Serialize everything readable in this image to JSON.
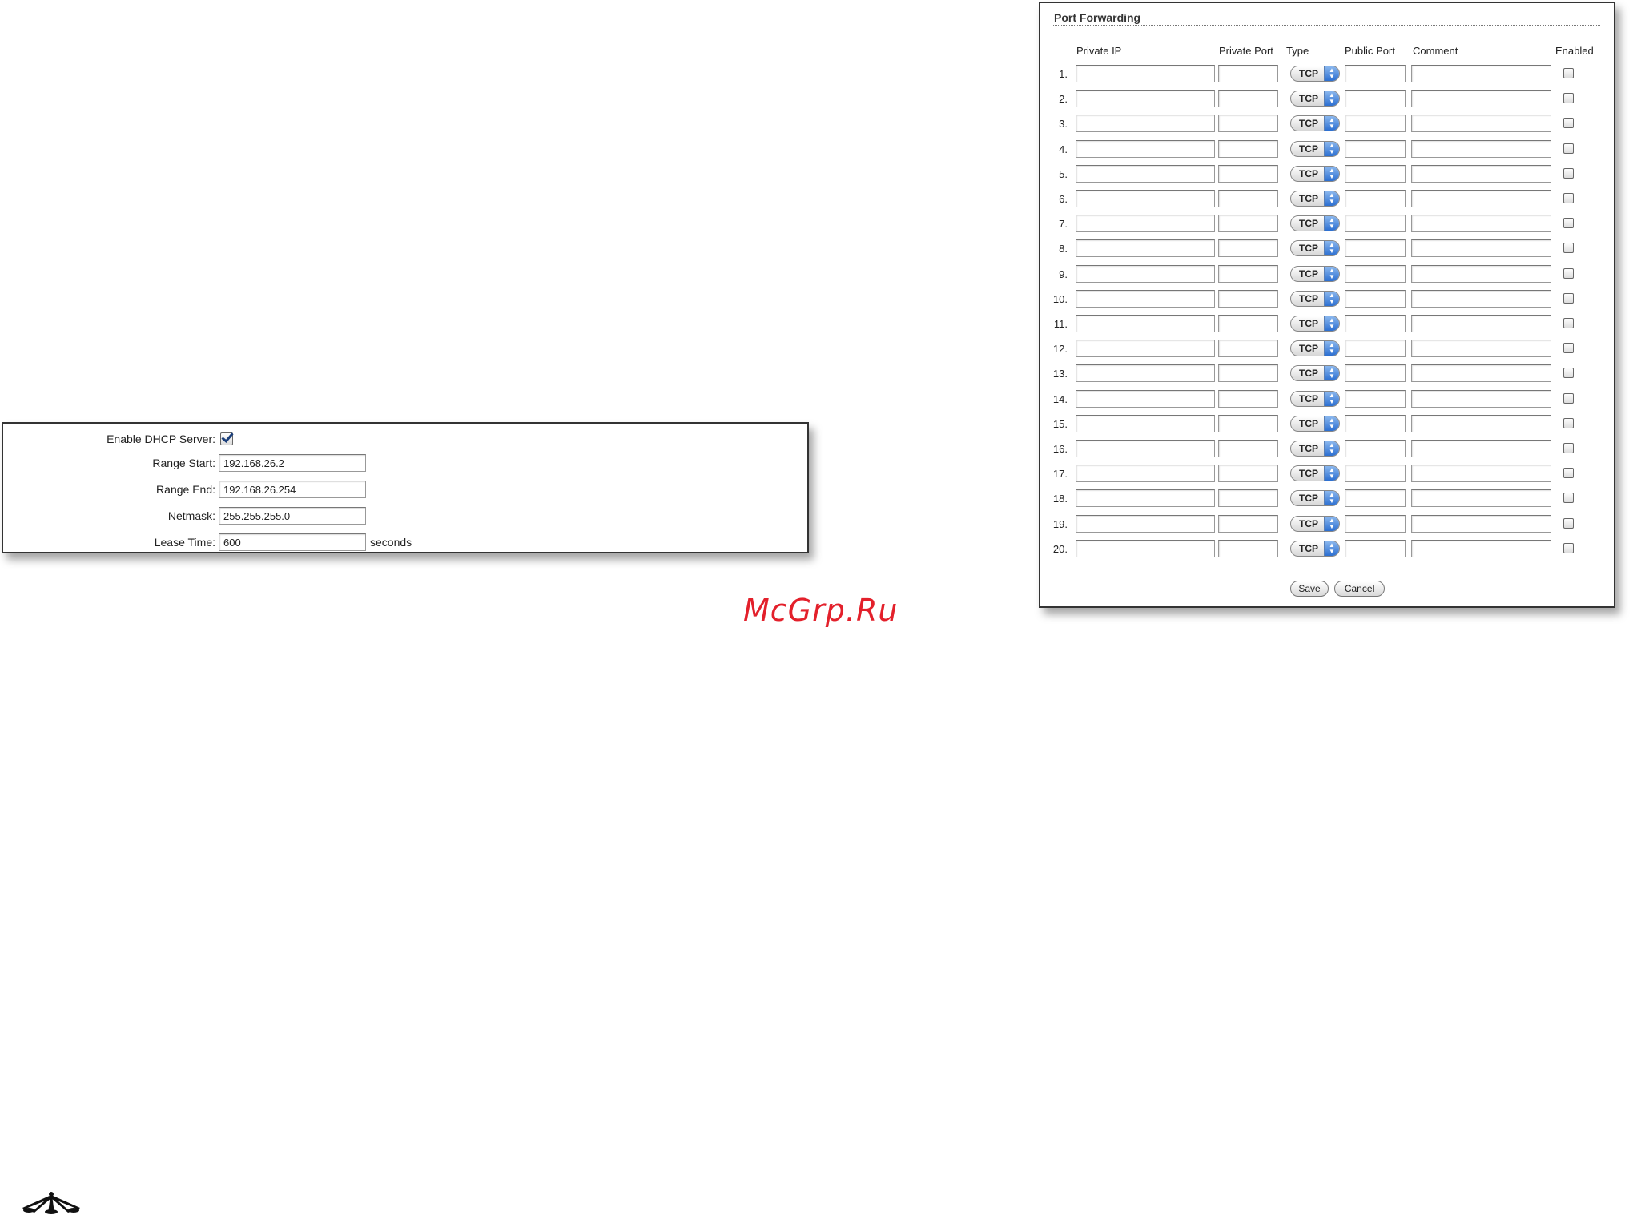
{
  "dhcp": {
    "enable_label": "Enable DHCP Server:",
    "enabled": true,
    "range_start_label": "Range Start:",
    "range_start_value": "192.168.26.2",
    "range_end_label": "Range End:",
    "range_end_value": "192.168.26.254",
    "netmask_label": "Netmask:",
    "netmask_value": "255.255.255.0",
    "lease_time_label": "Lease Time:",
    "lease_time_value": "600",
    "lease_time_unit": "seconds"
  },
  "watermark": "McGrp.Ru",
  "port_forwarding": {
    "title": "Port Forwarding",
    "headers": {
      "private_ip": "Private IP",
      "private_port": "Private Port",
      "type": "Type",
      "public_port": "Public Port",
      "comment": "Comment",
      "enabled": "Enabled"
    },
    "rows": [
      {
        "num": "1.",
        "type": "TCP",
        "enabled": false
      },
      {
        "num": "2.",
        "type": "TCP",
        "enabled": false
      },
      {
        "num": "3.",
        "type": "TCP",
        "enabled": false
      },
      {
        "num": "4.",
        "type": "TCP",
        "enabled": false
      },
      {
        "num": "5.",
        "type": "TCP",
        "enabled": false
      },
      {
        "num": "6.",
        "type": "TCP",
        "enabled": false
      },
      {
        "num": "7.",
        "type": "TCP",
        "enabled": false
      },
      {
        "num": "8.",
        "type": "TCP",
        "enabled": false
      },
      {
        "num": "9.",
        "type": "TCP",
        "enabled": false
      },
      {
        "num": "10.",
        "type": "TCP",
        "enabled": false
      },
      {
        "num": "11.",
        "type": "TCP",
        "enabled": false
      },
      {
        "num": "12.",
        "type": "TCP",
        "enabled": false
      },
      {
        "num": "13.",
        "type": "TCP",
        "enabled": false
      },
      {
        "num": "14.",
        "type": "TCP",
        "enabled": false
      },
      {
        "num": "15.",
        "type": "TCP",
        "enabled": false
      },
      {
        "num": "16.",
        "type": "TCP",
        "enabled": false
      },
      {
        "num": "17.",
        "type": "TCP",
        "enabled": false
      },
      {
        "num": "18.",
        "type": "TCP",
        "enabled": false
      },
      {
        "num": "19.",
        "type": "TCP",
        "enabled": false
      },
      {
        "num": "20.",
        "type": "TCP",
        "enabled": false
      }
    ],
    "save_label": "Save",
    "cancel_label": "Cancel"
  },
  "footer": {
    "logo_icon": "ubiquiti-logo-icon"
  },
  "colors": {
    "watermark": "#e3202b",
    "select_arrow": "#2c6fd1",
    "checkmark": "#1b3f7a"
  }
}
